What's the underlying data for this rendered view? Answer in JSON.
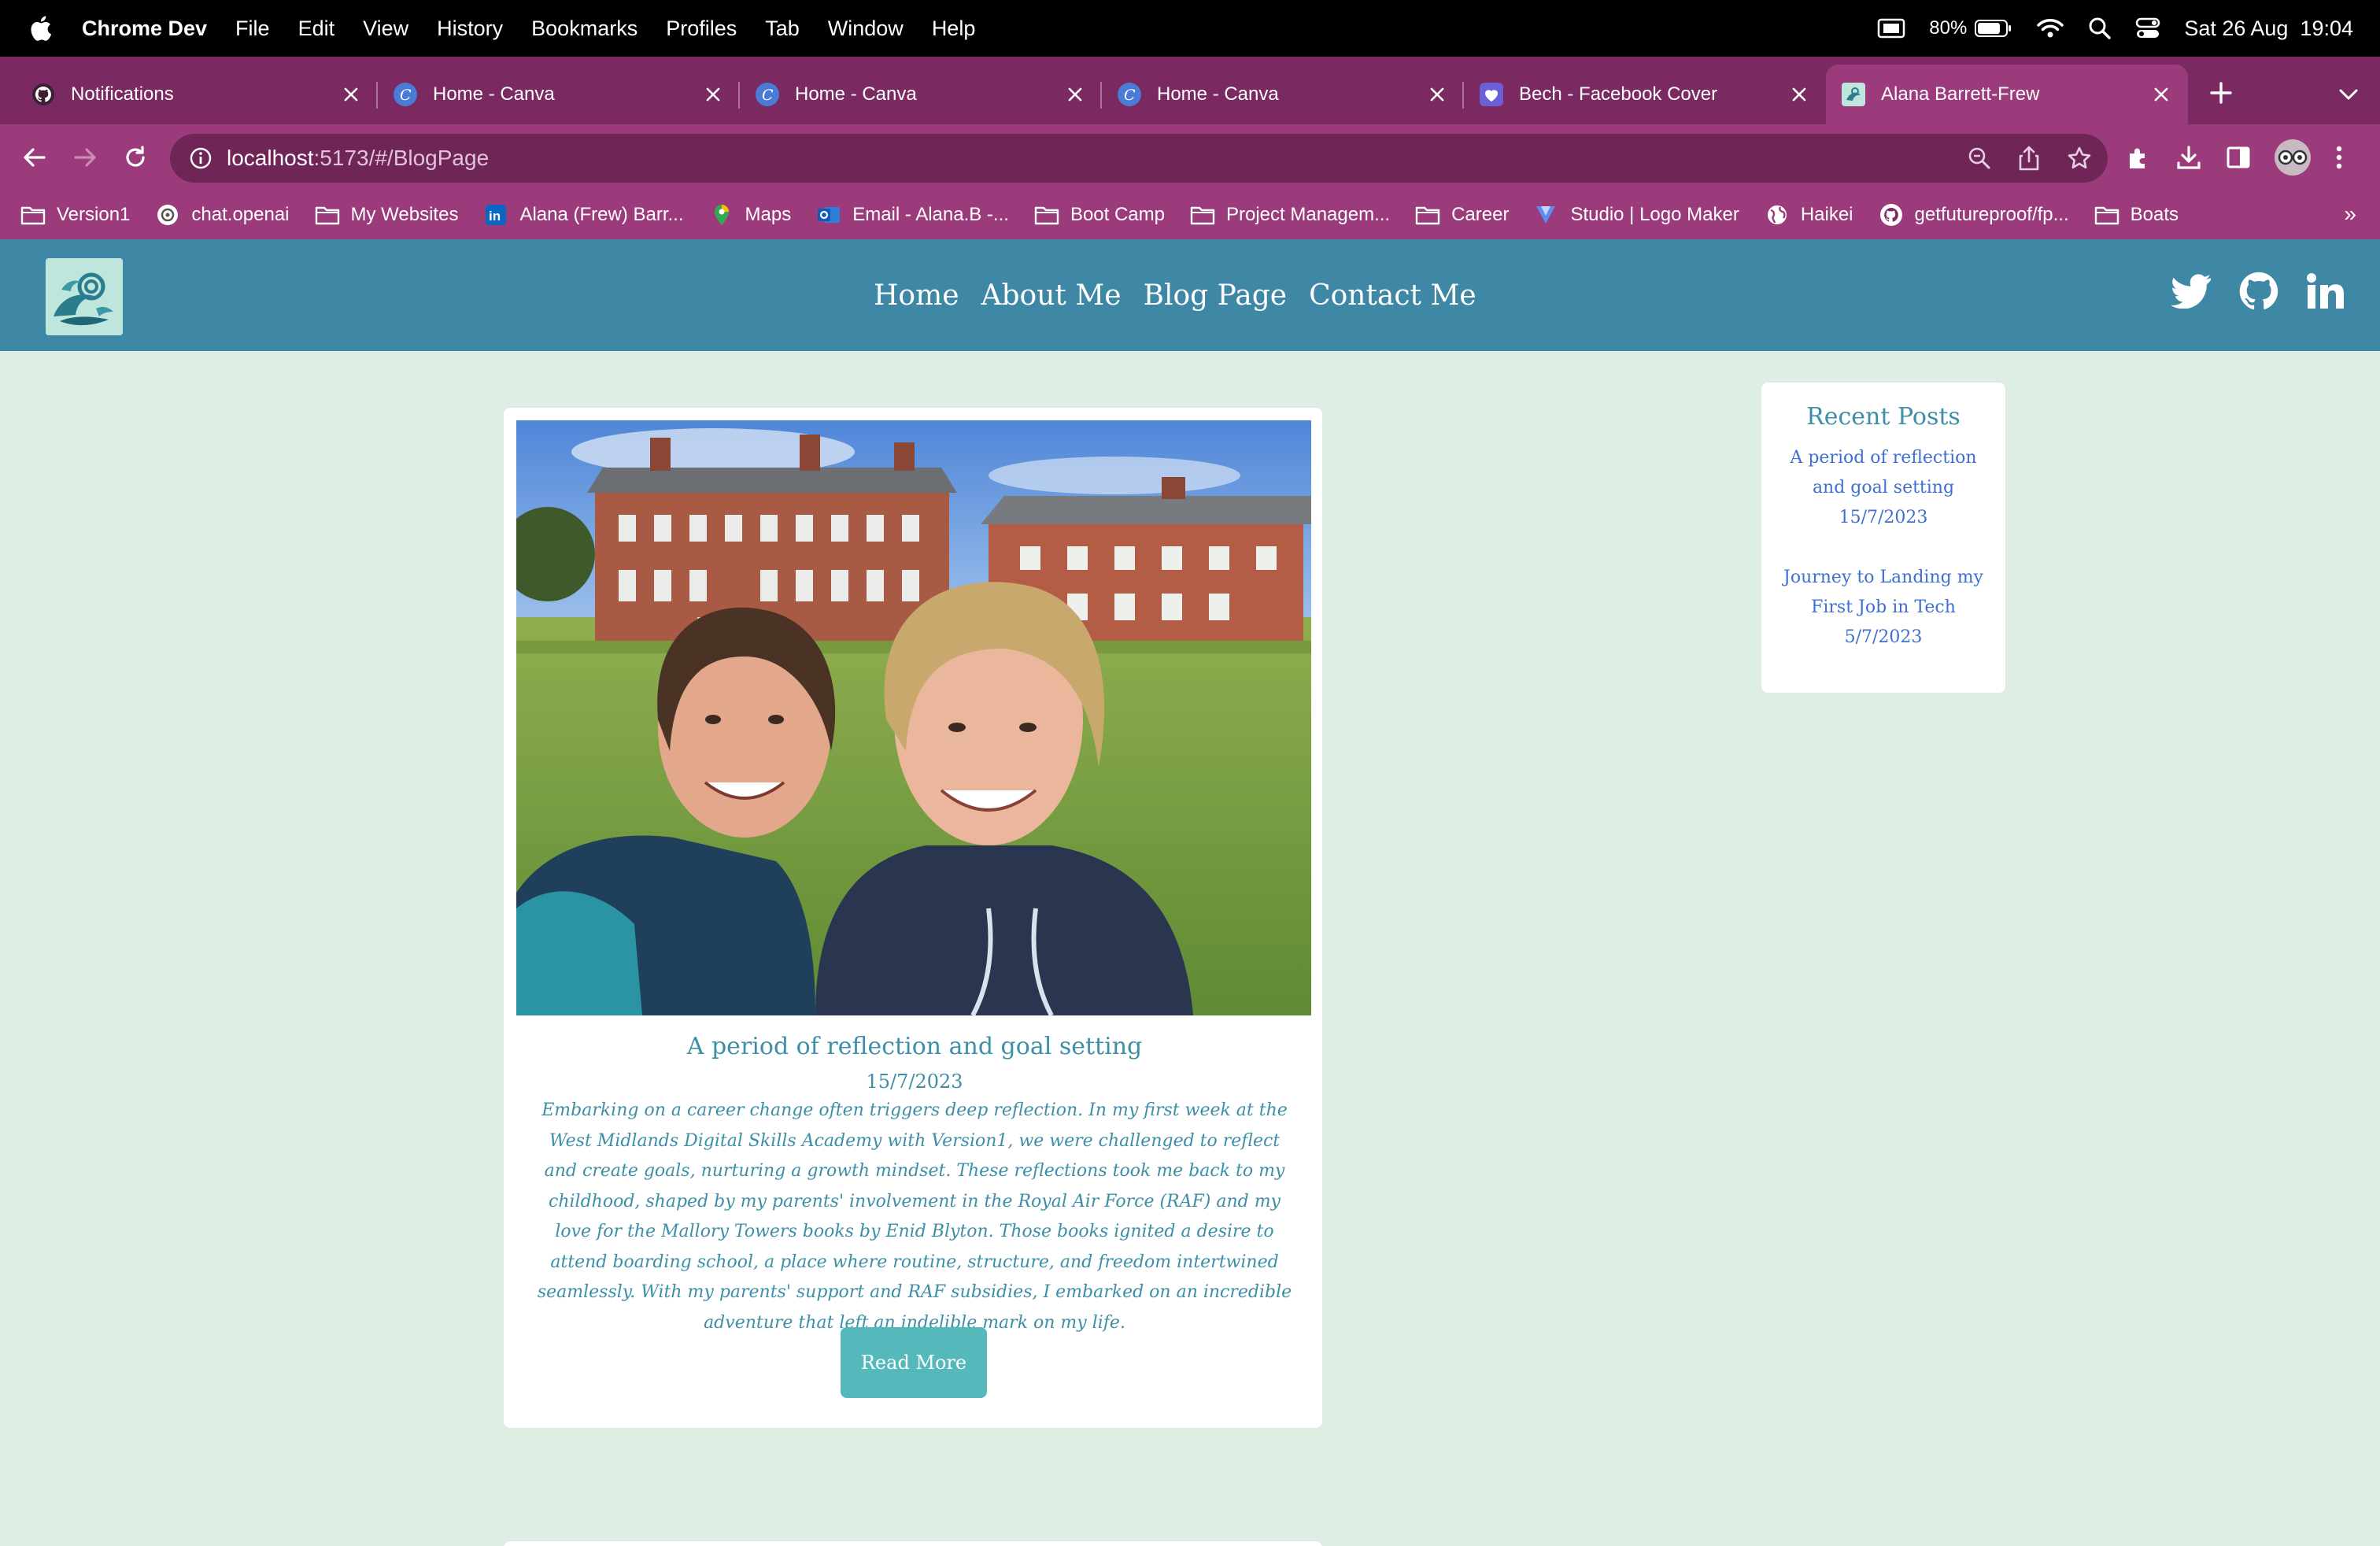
{
  "menubar": {
    "app_name": "Chrome Dev",
    "items": [
      "File",
      "Edit",
      "View",
      "History",
      "Bookmarks",
      "Profiles",
      "Tab",
      "Window",
      "Help"
    ],
    "battery_percent": "80%",
    "datetime": "Sat 26 Aug  19:04"
  },
  "tabs": [
    {
      "title": "Notifications",
      "icon": "github-icon"
    },
    {
      "title": "Home - Canva",
      "icon": "canva-icon"
    },
    {
      "title": "Home - Canva",
      "icon": "canva-icon"
    },
    {
      "title": "Home - Canva",
      "icon": "canva-icon"
    },
    {
      "title": "Bech - Facebook Cover",
      "icon": "heart-icon"
    },
    {
      "title": "Alana Barrett-Frew",
      "icon": "site-icon",
      "active": true
    }
  ],
  "address_bar": {
    "host": "localhost",
    "path": ":5173/#/BlogPage"
  },
  "bookmarks": [
    {
      "label": "Version1",
      "icon": "folder-icon"
    },
    {
      "label": "chat.openai",
      "icon": "openai-icon"
    },
    {
      "label": "My Websites",
      "icon": "folder-icon"
    },
    {
      "label": "Alana (Frew) Barr...",
      "icon": "linkedin-icon"
    },
    {
      "label": "Maps",
      "icon": "maps-icon"
    },
    {
      "label": "Email - Alana.B -...",
      "icon": "outlook-icon"
    },
    {
      "label": "Boot Camp",
      "icon": "folder-icon"
    },
    {
      "label": "Project Managem...",
      "icon": "folder-icon"
    },
    {
      "label": "Career",
      "icon": "folder-icon"
    },
    {
      "label": "Studio | Logo Maker",
      "icon": "logo-maker-icon"
    },
    {
      "label": "Haikei",
      "icon": "globe-icon"
    },
    {
      "label": "getfutureproof/fp...",
      "icon": "github-icon"
    },
    {
      "label": "Boats",
      "icon": "folder-icon"
    }
  ],
  "bookmarks_more": "»",
  "site": {
    "nav": [
      "Home",
      "About Me",
      "Blog Page",
      "Contact Me"
    ],
    "socials": [
      "twitter-icon",
      "github-icon",
      "linkedin-icon"
    ]
  },
  "post": {
    "title": "A period of reflection and goal setting",
    "date": "15/7/2023",
    "body": "Embarking on a career change often triggers deep reflection. In my first week at the West Midlands Digital Skills Academy with Version1, we were challenged to reflect and create goals, nurturing a growth mindset. These reflections took me back to my childhood, shaped by my parents' involvement in the Royal Air Force (RAF) and my love for the Mallory Towers books by Enid Blyton. Those books ignited a desire to attend boarding school, a place where routine, structure, and freedom intertwined seamlessly. With my parents' support and RAF subsidies, I embarked on an incredible adventure that left an indelible mark on my life.",
    "read_more": "Read More"
  },
  "recent_posts": {
    "title": "Recent Posts",
    "items": [
      "A period of reflection and goal setting 15/7/2023",
      "Journey to Landing my First Job in Tech 5/7/2023"
    ]
  },
  "colors": {
    "page_bg": "#dcefe2",
    "header_bg": "#3e87a5",
    "browser_tabs_bg": "#7a2a60",
    "browser_toolbar_bg": "#9b3b7c",
    "accent_text": "#3c8fa7",
    "button_bg": "#55b8bb",
    "link": "#3f6fd0"
  }
}
